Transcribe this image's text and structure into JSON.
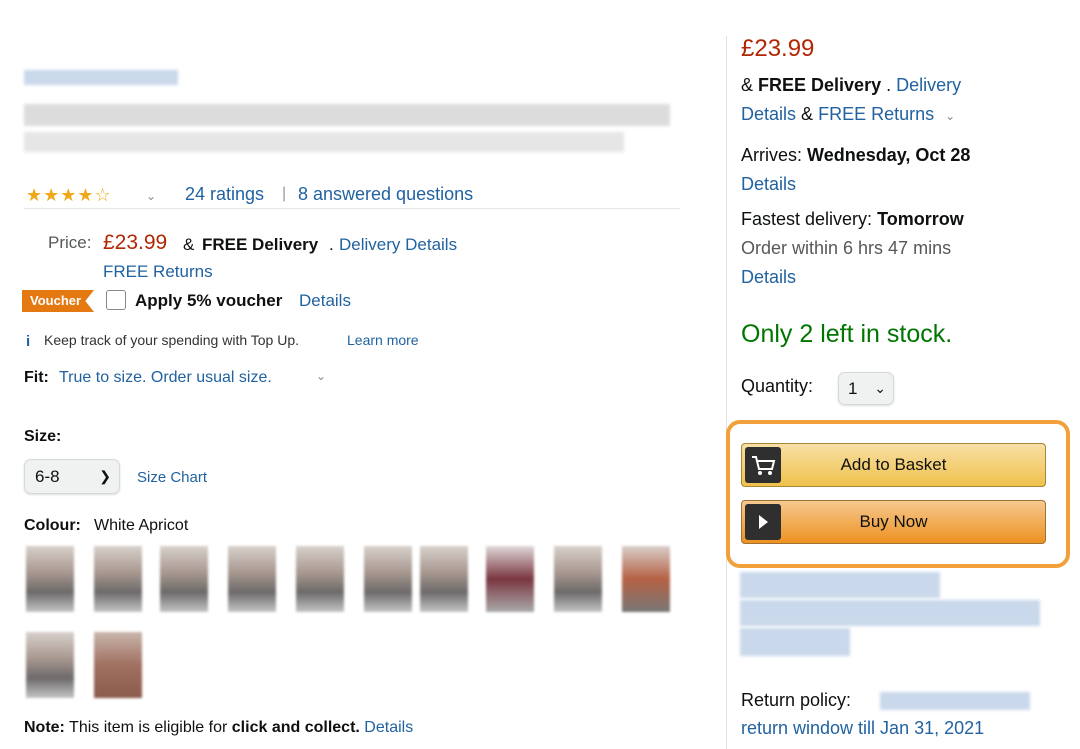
{
  "product": {
    "ratings_count": "24 ratings",
    "answered_questions": "8 answered questions",
    "price_label": "Price:",
    "price": "£23.99",
    "amp": "&",
    "free_delivery": "FREE Delivery",
    "dot": ".",
    "delivery_details_link": "Delivery Details",
    "free_returns_link": "FREE Returns",
    "voucher_tag": "Voucher",
    "voucher_text": "Apply 5% voucher",
    "voucher_details_link": "Details",
    "info_icon": "i",
    "topup_text": "Keep track of your spending with Top Up.",
    "learn_more_link": "Learn more",
    "fit_label": "Fit:",
    "fit_text": "True to size. Order usual size.",
    "size_label": "Size:",
    "size_value": "6-8",
    "size_chart_link": "Size Chart",
    "colour_label": "Colour:",
    "colour_value": "White Apricot",
    "note_label": "Note:",
    "note_text": "This item is eligible for",
    "note_bold": "click and collect.",
    "note_details_link": "Details",
    "stars_icon": "star-rating-icon"
  },
  "buybox": {
    "price": "£23.99",
    "amp": "&",
    "free_delivery": "FREE Delivery",
    "dot": ".",
    "delivery_link": "Delivery",
    "details_link": "Details",
    "amp2": "&",
    "free_returns_link": "FREE Returns",
    "arrives_label": "Arrives:",
    "arrives_date": "Wednesday, Oct 28",
    "arrives_details_link": "Details",
    "fastest_label": "Fastest delivery:",
    "fastest_value": "Tomorrow",
    "order_within": "Order within 6 hrs 47 mins",
    "fastest_details_link": "Details",
    "in_stock": "Only 2 left in stock.",
    "quantity_label": "Quantity:",
    "quantity_value": "1",
    "add_to_basket": "Add to Basket",
    "buy_now": "Buy Now",
    "return_policy_label": "Return policy:",
    "return_window_link": "return window till Jan 31, 2021"
  },
  "colors": {
    "link": "#2162a1",
    "price": "#b12704",
    "in_stock": "#007600",
    "highlight": "#f1a03b",
    "voucher": "#e47911"
  }
}
